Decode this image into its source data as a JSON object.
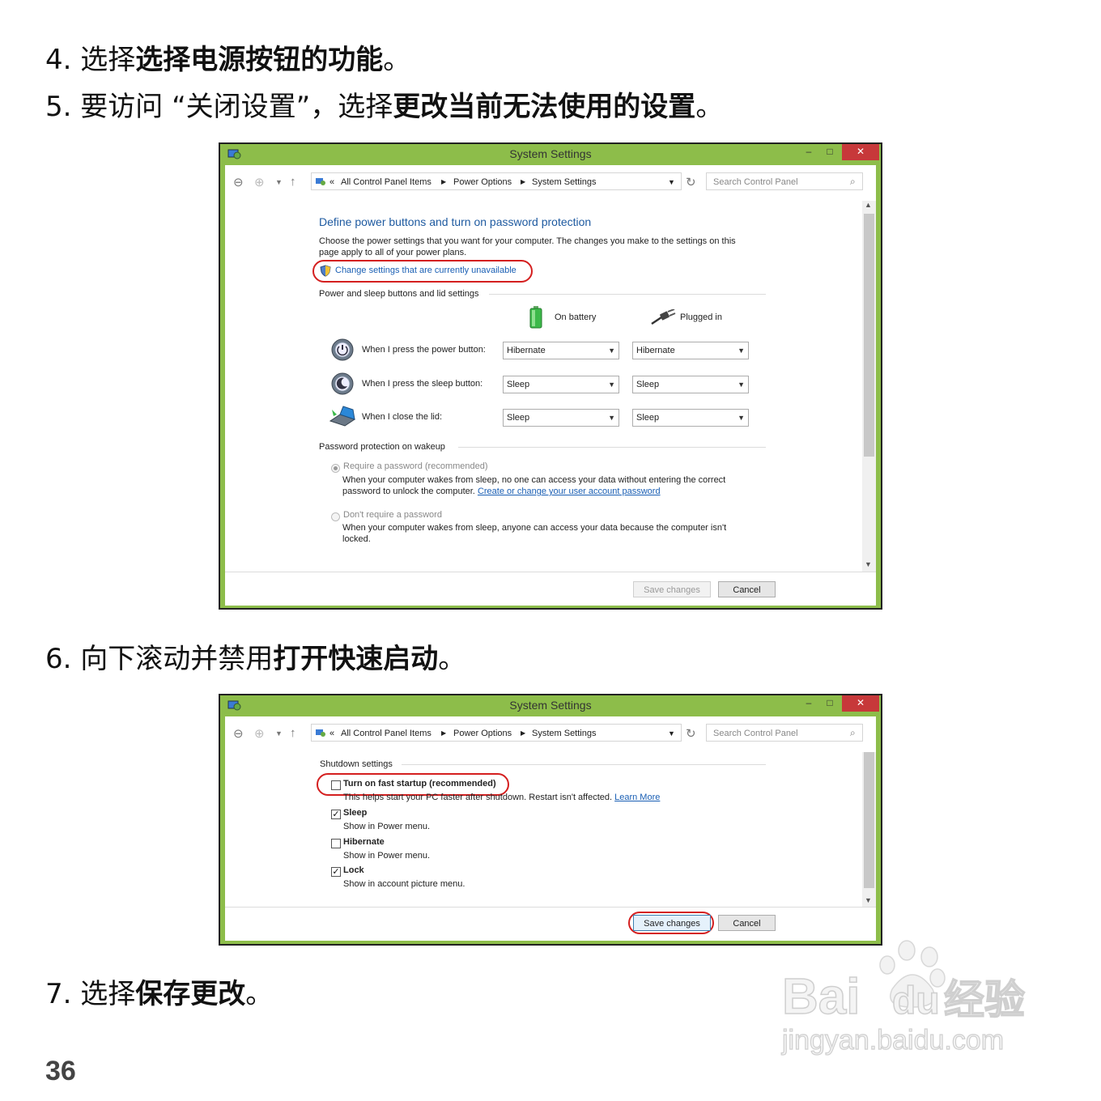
{
  "steps": {
    "s4": {
      "num": "4.",
      "plain": "选择",
      "bold": "选择电源按钮的功能",
      "end": "。"
    },
    "s5": {
      "num": "5.",
      "plain": "要访问 “关闭设置”，选择",
      "bold": "更改当前无法使用的设置",
      "end": "。"
    },
    "s6": {
      "num": "6.",
      "plain": "向下滚动并禁用",
      "bold": "打开快速启动",
      "end": "。"
    },
    "s7": {
      "num": "7.",
      "plain": "选择",
      "bold": "保存更改",
      "end": "。"
    }
  },
  "page_number": "36",
  "window": {
    "title": "System Settings",
    "min_label": "–",
    "max_label": "□",
    "close_label": "✕",
    "breadcrumb_prefix": "«",
    "breadcrumb": [
      "All Control Panel Items",
      "Power Options",
      "System Settings"
    ],
    "search_placeholder": "Search Control Panel"
  },
  "win1": {
    "heading": "Define power buttons and turn on password protection",
    "desc_line1": "Choose the power settings that you want for your computer. The changes you make to the settings on this",
    "desc_line2": "page apply to all of your power plans.",
    "change_link": "Change settings that are currently unavailable",
    "section1": "Power and sleep buttons and lid settings",
    "col_battery": "On battery",
    "col_plugged": "Plugged in",
    "rows": [
      {
        "label": "When I press the power button:",
        "battery": "Hibernate",
        "plugged": "Hibernate"
      },
      {
        "label": "When I press the sleep button:",
        "battery": "Sleep",
        "plugged": "Sleep"
      },
      {
        "label": "When I close the lid:",
        "battery": "Sleep",
        "plugged": "Sleep"
      }
    ],
    "section2": "Password protection on wakeup",
    "opt1_label": "Require a password (recommended)",
    "opt1_desc1": "When your computer wakes from sleep, no one can access your data without entering the correct",
    "opt1_desc2": "password to unlock the computer.",
    "opt1_link": "Create or change your user account password",
    "opt2_label": "Don't require a password",
    "opt2_desc1": "When your computer wakes from sleep, anyone can access your data because the computer isn't",
    "opt2_desc2": "locked.",
    "save": "Save changes",
    "cancel": "Cancel"
  },
  "win2": {
    "section": "Shutdown settings",
    "fast_startup": {
      "label": "Turn on fast startup (recommended)",
      "desc": "This helps start your PC faster after shutdown. Restart isn't affected.",
      "link": "Learn More",
      "checked": false
    },
    "sleep": {
      "label": "Sleep",
      "desc": "Show in Power menu.",
      "checked": true
    },
    "hibernate": {
      "label": "Hibernate",
      "desc": "Show in Power menu.",
      "checked": false
    },
    "lock": {
      "label": "Lock",
      "desc": "Show in account picture menu.",
      "checked": true
    },
    "save": "Save changes",
    "cancel": "Cancel"
  },
  "watermark": {
    "brand": "Bai",
    "brand2": "du",
    "cn": "经验",
    "url": "jingyan.baidu.com"
  },
  "colors": {
    "window_frame": "#8dbd4a",
    "close_button": "#c7383a",
    "highlight_oval": "#d41f1f",
    "link": "#1a5fb4",
    "heading": "#1e5aa0"
  }
}
